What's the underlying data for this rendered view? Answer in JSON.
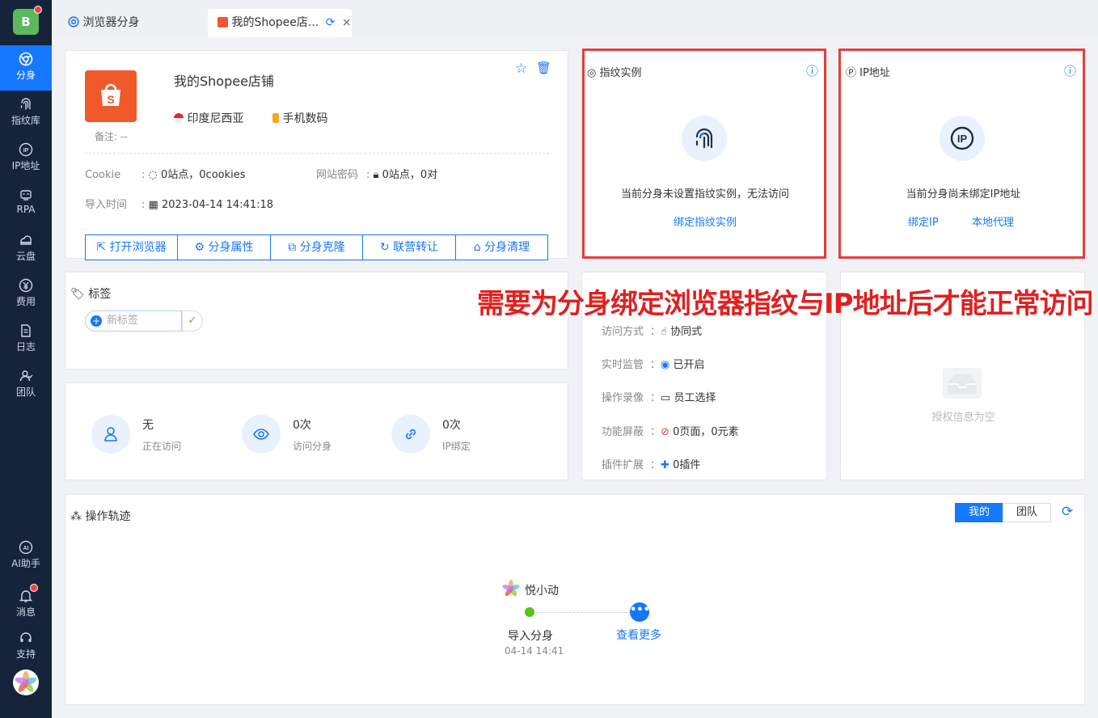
{
  "sidebar": {
    "logo": "B",
    "items": [
      {
        "label": "分身",
        "icon": "chrome-icon"
      },
      {
        "label": "指纹库",
        "icon": "fingerprint-icon"
      },
      {
        "label": "IP地址",
        "icon": "ip-icon"
      },
      {
        "label": "RPA",
        "icon": "robot-icon"
      },
      {
        "label": "云盘",
        "icon": "cloud-drive-icon"
      },
      {
        "label": "费用",
        "icon": "yen-icon"
      },
      {
        "label": "日志",
        "icon": "log-icon"
      },
      {
        "label": "团队",
        "icon": "team-icon"
      }
    ],
    "bottom": [
      {
        "label": "AI助手",
        "icon": "ai-icon"
      },
      {
        "label": "消息",
        "icon": "bell-icon"
      },
      {
        "label": "支持",
        "icon": "headset-icon"
      }
    ]
  },
  "tabs": [
    {
      "label": "浏览器分身"
    },
    {
      "label": "我的Shopee店..."
    }
  ],
  "profile": {
    "name": "我的Shopee店铺",
    "region": "印度尼西亚",
    "category": "手机数码",
    "remark_label": "备注:",
    "remark_value": "--",
    "cookie_label": "Cookie",
    "cookie_value": "0站点，0cookies",
    "password_label": "网站密码",
    "password_value": "0站点，0对",
    "import_label": "导入时间",
    "import_value": "2023-04-14 14:41:18",
    "buttons": [
      "打开浏览器",
      "分身属性",
      "分身克隆",
      "联营转让",
      "分身清理"
    ]
  },
  "fingerprint": {
    "title": "指纹实例",
    "message": "当前分身未设置指纹实例，无法访问",
    "link": "绑定指纹实例"
  },
  "ip": {
    "title": "IP地址",
    "message": "当前分身尚未绑定IP地址",
    "link1": "绑定IP",
    "link2": "本地代理"
  },
  "overlay_text": "需要为分身绑定浏览器指纹与IP地址后才能正常访问",
  "tags": {
    "title": "标签",
    "placeholder": "新标签"
  },
  "stats": [
    {
      "value": "无",
      "label": "正在访问"
    },
    {
      "value": "0次",
      "label": "访问分身"
    },
    {
      "value": "0次",
      "label": "IP绑定"
    }
  ],
  "settings": [
    {
      "key": "访问方式",
      "value": "协同式"
    },
    {
      "key": "实时监管",
      "value": "已开启"
    },
    {
      "key": "操作录像",
      "value": "员工选择"
    },
    {
      "key": "功能屏蔽",
      "value": "0页面，0元素"
    },
    {
      "key": "插件扩展",
      "value": "0插件"
    }
  ],
  "auth": {
    "empty": "授权信息为空"
  },
  "trail": {
    "title": "操作轨迹",
    "seg_mine": "我的",
    "seg_team": "团队",
    "user": "悦小动",
    "event": "导入分身",
    "time": "04-14 14:41",
    "more": "查看更多"
  },
  "colors": {
    "sidebar_bg": "#15243b",
    "accent": "#1677ff",
    "highlight_red": "#e53e3e",
    "shopee": "#f05a2a"
  }
}
